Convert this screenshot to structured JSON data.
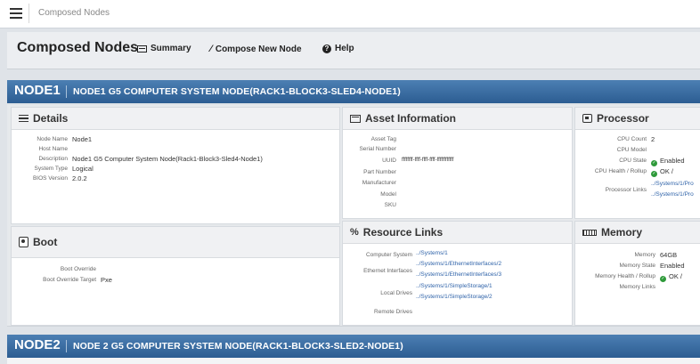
{
  "breadcrumb": "Composed Nodes",
  "page": {
    "title": "Composed Nodes",
    "summary_label": "Summary",
    "compose_label": "Compose New Node",
    "help_label": "Help"
  },
  "node1": {
    "id": "NODE1",
    "description": "NODE1 G5 COMPUTER SYSTEM NODE(RACK1-BLOCK3-SLED4-NODE1)",
    "details": {
      "title": "Details",
      "rows": [
        {
          "label": "Node Name",
          "value": "Node1"
        },
        {
          "label": "Host Name",
          "value": ""
        },
        {
          "label": "Description",
          "value": "Node1 G5 Computer System Node(Rack1-Block3-Sled4-Node1)"
        },
        {
          "label": "System Type",
          "value": "Logical"
        },
        {
          "label": "BIOS Version",
          "value": "2.0.2"
        }
      ]
    },
    "asset": {
      "title": "Asset Information",
      "rows": [
        {
          "label": "Asset Tag",
          "value": ""
        },
        {
          "label": "Serial Number",
          "value": ""
        },
        {
          "label": "UUID",
          "value": "ffffffff-ffff-ffff-ffff-ffffffffffff"
        },
        {
          "label": "Part Number",
          "value": ""
        },
        {
          "label": "Manufacturer",
          "value": ""
        },
        {
          "label": "Model",
          "value": ""
        },
        {
          "label": "SKU",
          "value": ""
        }
      ]
    },
    "processor": {
      "title": "Processor",
      "cpu_count_label": "CPU Count",
      "cpu_count": "2",
      "cpu_model_label": "CPU Model",
      "cpu_model": "",
      "cpu_state_label": "CPU State",
      "cpu_state": "Enabled",
      "cpu_health_label": "CPU Health / Rollup",
      "cpu_health": "OK  /",
      "links_label": "Processor Links",
      "links": [
        "../Systems/1/Pro",
        "../Systems/1/Pro"
      ]
    },
    "boot": {
      "title": "Boot",
      "override_label": "Boot Override",
      "override_value": "",
      "target_label": "Boot Override Target",
      "target_value": "Pxe"
    },
    "resources": {
      "title": "Resource Links",
      "computer_system_label": "Computer System",
      "computer_system": "../Systems/1",
      "ethernet_label": "Ethernet Interfaces",
      "ethernet": [
        "../Systems/1/EthernetInterfaces/2",
        "../Systems/1/EthernetInterfaces/3"
      ],
      "local_drives_label": "Local Drives",
      "local_drives": [
        "../Systems/1/SimpleStorage/1",
        "../Systems/1/SimpleStorage/2"
      ],
      "remote_drives_label": "Remote Drives"
    },
    "memory": {
      "title": "Memory",
      "memory_label": "Memory",
      "memory": "64GB",
      "state_label": "Memory State",
      "state": "Enabled",
      "health_label": "Memory Health / Rollup",
      "health": "OK  /",
      "links_label": "Memory Links"
    }
  },
  "node2": {
    "id": "NODE2",
    "description": "NODE 2 G5 COMPUTER SYSTEM NODE(RACK1-BLOCK3-SLED2-NODE1)"
  },
  "colors": {
    "header_blue": "#2c5d92",
    "link_blue": "#2f63a9",
    "ok_green": "#2e9a3a"
  }
}
